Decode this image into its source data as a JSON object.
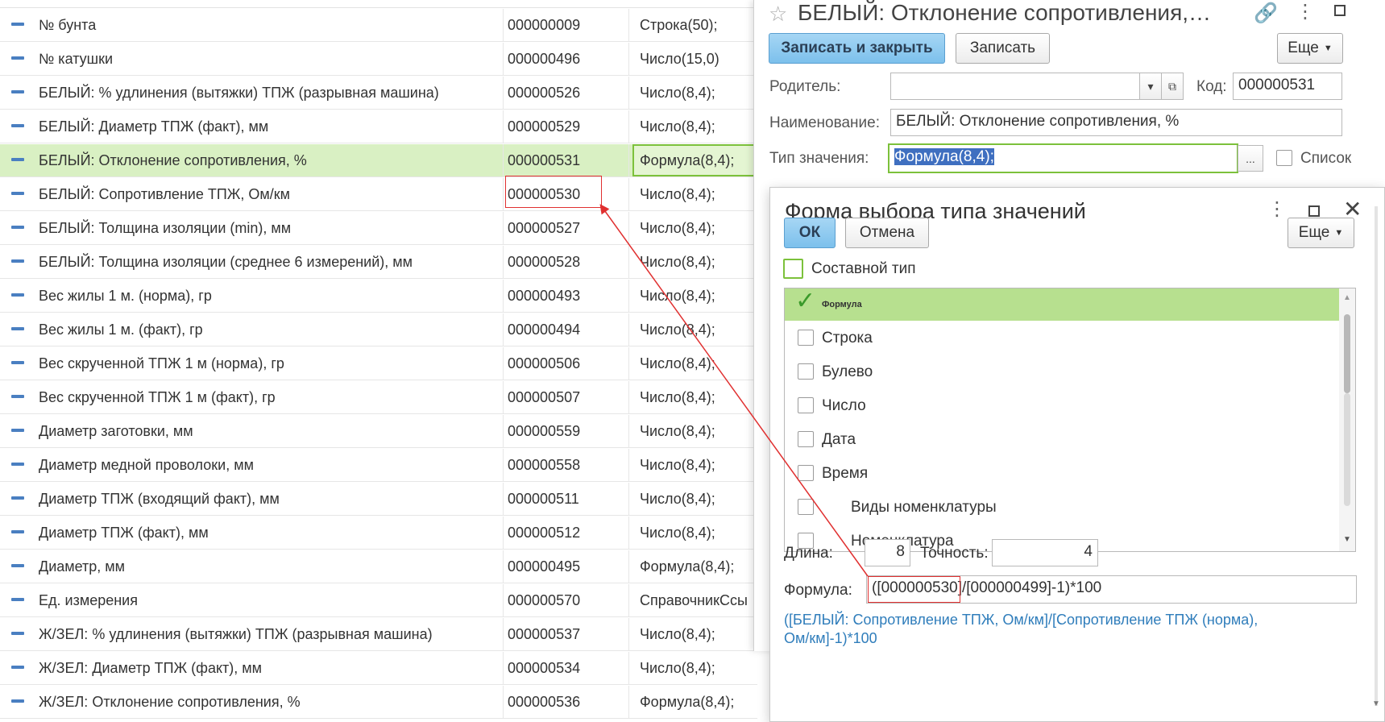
{
  "list": {
    "rows": [
      {
        "name": "№ бунта",
        "code": "000000009",
        "type": "Строка(50);"
      },
      {
        "name": "№ катушки",
        "code": "000000496",
        "type": "Число(15,0)"
      },
      {
        "name": "БЕЛЫЙ: % удлинения (вытяжки) ТПЖ (разрывная машина)",
        "code": "000000526",
        "type": "Число(8,4);"
      },
      {
        "name": "БЕЛЫЙ: Диаметр ТПЖ (факт), мм",
        "code": "000000529",
        "type": "Число(8,4);"
      },
      {
        "name": "БЕЛЫЙ: Отклонение сопротивления, %",
        "code": "000000531",
        "type": "Формула(8,4);"
      },
      {
        "name": "БЕЛЫЙ: Сопротивление ТПЖ, Ом/км",
        "code": "000000530",
        "type": "Число(8,4);"
      },
      {
        "name": "БЕЛЫЙ: Толщина изоляции (min), мм",
        "code": "000000527",
        "type": "Число(8,4);"
      },
      {
        "name": "БЕЛЫЙ: Толщина изоляции (среднее 6 измерений), мм",
        "code": "000000528",
        "type": "Число(8,4);"
      },
      {
        "name": "Вес жилы 1 м. (норма), гр",
        "code": "000000493",
        "type": "Число(8,4);"
      },
      {
        "name": "Вес жилы 1 м. (факт), гр",
        "code": "000000494",
        "type": "Число(8,4);"
      },
      {
        "name": "Вес скрученной ТПЖ 1 м (норма), гр",
        "code": "000000506",
        "type": "Число(8,4);"
      },
      {
        "name": "Вес скрученной ТПЖ 1 м (факт), гр",
        "code": "000000507",
        "type": "Число(8,4);"
      },
      {
        "name": "Диаметр заготовки, мм",
        "code": "000000559",
        "type": "Число(8,4);"
      },
      {
        "name": "Диаметр медной проволоки, мм",
        "code": "000000558",
        "type": "Число(8,4);"
      },
      {
        "name": "Диаметр ТПЖ (входящий факт), мм",
        "code": "000000511",
        "type": "Число(8,4);"
      },
      {
        "name": "Диаметр ТПЖ (факт), мм",
        "code": "000000512",
        "type": "Число(8,4);"
      },
      {
        "name": "Диаметр, мм",
        "code": "000000495",
        "type": "Формула(8,4);"
      },
      {
        "name": "Ед. измерения",
        "code": "000000570",
        "type": "СправочникСсы"
      },
      {
        "name": "Ж/ЗЕЛ: % удлинения (вытяжки) ТПЖ (разрывная машина)",
        "code": "000000537",
        "type": "Число(8,4);"
      },
      {
        "name": "Ж/ЗЕЛ: Диаметр ТПЖ (факт), мм",
        "code": "000000534",
        "type": "Число(8,4);"
      },
      {
        "name": "Ж/ЗЕЛ: Отклонение сопротивления, %",
        "code": "000000536",
        "type": "Формула(8,4);"
      }
    ]
  },
  "form": {
    "title": "БЕЛЫЙ: Отклонение сопротивления,…",
    "save_close_label": "Записать и закрыть",
    "save_label": "Записать",
    "more_label": "Еще",
    "parent_label": "Родитель:",
    "parent_value": "",
    "code_label": "Код:",
    "code_value": "000000531",
    "name_label": "Наименование:",
    "name_value": "БЕЛЫЙ: Отклонение сопротивления, %",
    "type_label": "Тип значения:",
    "type_value": "Формула(8,4);",
    "list_label": "Список"
  },
  "dialog": {
    "title": "Форма выбора типа значений",
    "ok_label": "ОК",
    "cancel_label": "Отмена",
    "more_label": "Еще",
    "composite_label": "Составной тип",
    "types": [
      {
        "label": "Формула",
        "checked": true
      },
      {
        "label": "Строка",
        "checked": false
      },
      {
        "label": "Булево",
        "checked": false
      },
      {
        "label": "Число",
        "checked": false
      },
      {
        "label": "Дата",
        "checked": false
      },
      {
        "label": "Время",
        "checked": false
      },
      {
        "label": "Виды номенклатуры",
        "checked": false
      },
      {
        "label": "Номенклатура",
        "checked": false
      }
    ],
    "length_label": "Длина:",
    "length_value": "8",
    "precision_label": "Точность:",
    "precision_value": "4",
    "formula_label": "Формула:",
    "formula_value": "([000000530]/[000000499]-1)*100",
    "formula_description": "([БЕЛЫЙ: Сопротивление ТПЖ, Ом/км]/[Сопротивление ТПЖ (норма), Ом/км]-1)*100"
  },
  "colors": {
    "selected_row": "#d9f0c3",
    "accent_green": "#7cc13b",
    "primary_button": "#7cc0ec",
    "annotation_red": "#e03030",
    "link_blue": "#2f7dbb"
  }
}
